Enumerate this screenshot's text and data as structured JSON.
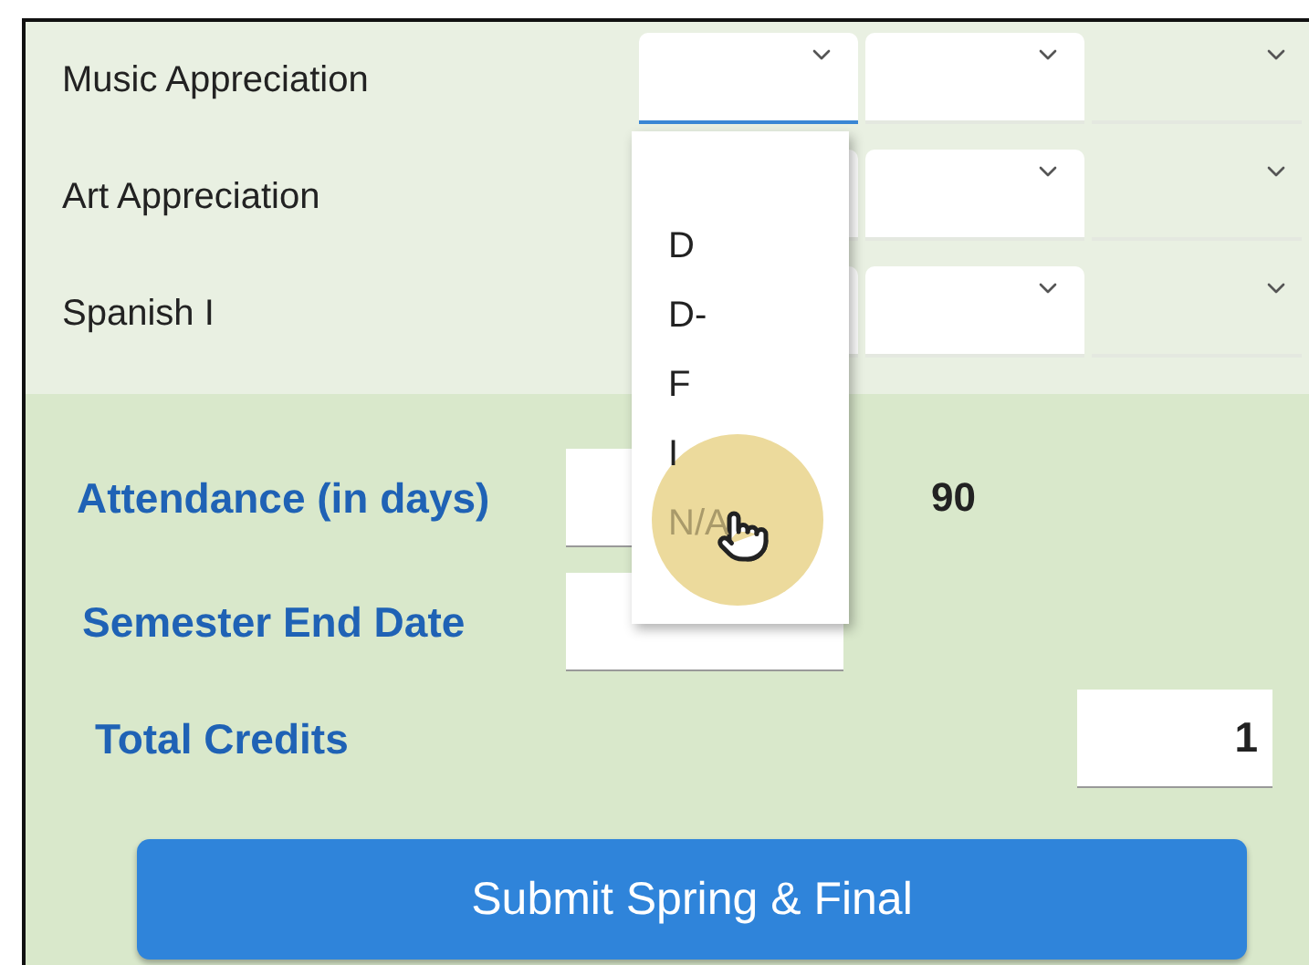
{
  "courses": [
    {
      "name": "Music Appreciation",
      "focused": true
    },
    {
      "name": "Art Appreciation",
      "focused": false
    },
    {
      "name": "Spanish I",
      "focused": false
    }
  ],
  "dropdown": {
    "options": [
      "D",
      "D-",
      "F",
      "I",
      "N/A"
    ]
  },
  "attendance": {
    "label": "Attendance (in days)",
    "value": "90"
  },
  "end_date": {
    "label": "Semester End Date"
  },
  "total_credits": {
    "label": "Total Credits",
    "value": "1"
  },
  "submit_button": "Submit Spring & Final"
}
